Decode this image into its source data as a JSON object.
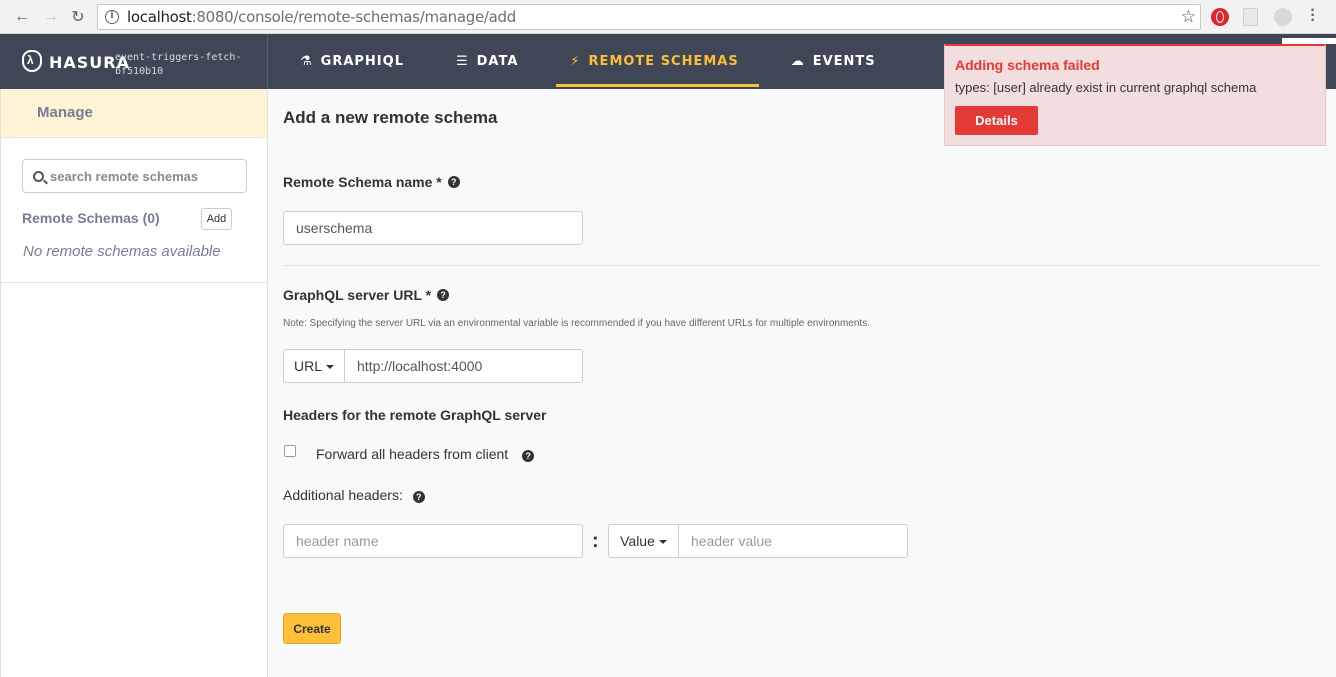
{
  "browser": {
    "url_host": "localhost",
    "url_rest": ":8080/console/remote-schemas/manage/add"
  },
  "header": {
    "logo_text": "HASURA",
    "project_line1": "event-triggers-fetch-",
    "project_line2": "bf510b10",
    "tabs": [
      {
        "label": "GRAPHIQL",
        "icon": "flask-icon",
        "glyph": "⚗",
        "active": false
      },
      {
        "label": "DATA",
        "icon": "database-icon",
        "glyph": "☰",
        "active": false
      },
      {
        "label": "REMOTE SCHEMAS",
        "icon": "plug-icon",
        "glyph": "⚡",
        "active": true
      },
      {
        "label": "EVENTS",
        "icon": "cloud-icon",
        "glyph": "☁",
        "active": false
      }
    ]
  },
  "sidebar": {
    "manage_label": "Manage",
    "search_placeholder": "search remote schemas",
    "remote_schemas_title": "Remote Schemas (0)",
    "add_label": "Add",
    "empty_text": "No remote schemas available"
  },
  "form": {
    "page_title": "Add a new remote schema",
    "name_label": "Remote Schema name *",
    "name_value": "userschema",
    "url_label": "GraphQL server URL *",
    "url_note": "Note: Specifying the server URL via an environmental variable is recommended if you have different URLs for multiple environments.",
    "url_type": "URL",
    "url_value": "http://localhost:4000",
    "headers_title": "Headers for the remote GraphQL server",
    "forward_headers_label": "Forward all headers from client",
    "forward_headers_checked": false,
    "additional_headers_label": "Additional headers:",
    "header_name_placeholder": "header name",
    "header_type": "Value",
    "header_value_placeholder": "header value",
    "create_label": "Create"
  },
  "notification": {
    "title": "Adding schema failed",
    "message": "types: [user] already exist in current graphql schema",
    "details_label": "Details",
    "color": "#e53935"
  },
  "colors": {
    "accent": "#fdbe38",
    "header_bg": "#3f4756",
    "error": "#e53935"
  }
}
